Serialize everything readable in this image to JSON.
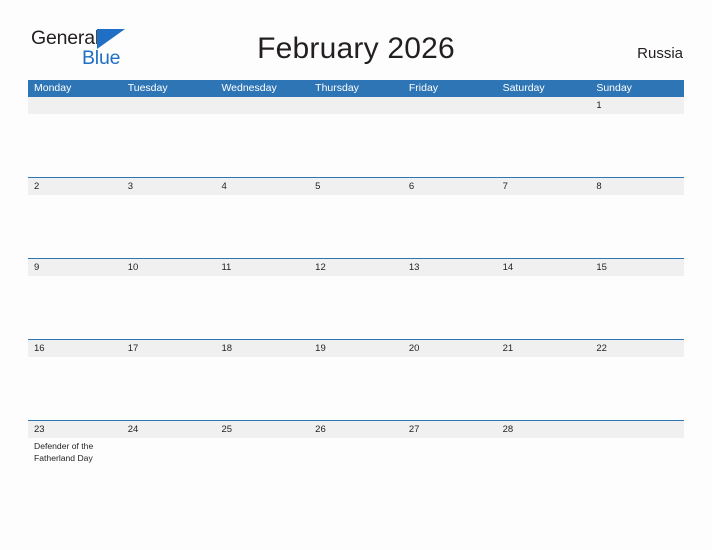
{
  "brand": {
    "name_part1": "General",
    "name_part2": "Blue",
    "accent_color": "#1f6fc4",
    "flag_icon": "blue-flag-triangle-icon"
  },
  "header": {
    "title": "February 2026",
    "country": "Russia"
  },
  "calendar": {
    "header_color": "#2e75b6",
    "date_band_color": "#f0f0f0",
    "weekday_headers": [
      "Monday",
      "Tuesday",
      "Wednesday",
      "Thursday",
      "Friday",
      "Saturday",
      "Sunday"
    ],
    "weeks": [
      {
        "days": [
          {
            "number": "",
            "events": []
          },
          {
            "number": "",
            "events": []
          },
          {
            "number": "",
            "events": []
          },
          {
            "number": "",
            "events": []
          },
          {
            "number": "",
            "events": []
          },
          {
            "number": "",
            "events": []
          },
          {
            "number": "1",
            "events": []
          }
        ]
      },
      {
        "days": [
          {
            "number": "2",
            "events": []
          },
          {
            "number": "3",
            "events": []
          },
          {
            "number": "4",
            "events": []
          },
          {
            "number": "5",
            "events": []
          },
          {
            "number": "6",
            "events": []
          },
          {
            "number": "7",
            "events": []
          },
          {
            "number": "8",
            "events": []
          }
        ]
      },
      {
        "days": [
          {
            "number": "9",
            "events": []
          },
          {
            "number": "10",
            "events": []
          },
          {
            "number": "11",
            "events": []
          },
          {
            "number": "12",
            "events": []
          },
          {
            "number": "13",
            "events": []
          },
          {
            "number": "14",
            "events": []
          },
          {
            "number": "15",
            "events": []
          }
        ]
      },
      {
        "days": [
          {
            "number": "16",
            "events": []
          },
          {
            "number": "17",
            "events": []
          },
          {
            "number": "18",
            "events": []
          },
          {
            "number": "19",
            "events": []
          },
          {
            "number": "20",
            "events": []
          },
          {
            "number": "21",
            "events": []
          },
          {
            "number": "22",
            "events": []
          }
        ]
      },
      {
        "days": [
          {
            "number": "23",
            "events": [
              "Defender of the Fatherland Day"
            ]
          },
          {
            "number": "24",
            "events": []
          },
          {
            "number": "25",
            "events": []
          },
          {
            "number": "26",
            "events": []
          },
          {
            "number": "27",
            "events": []
          },
          {
            "number": "28",
            "events": []
          },
          {
            "number": "",
            "events": []
          }
        ]
      }
    ]
  }
}
